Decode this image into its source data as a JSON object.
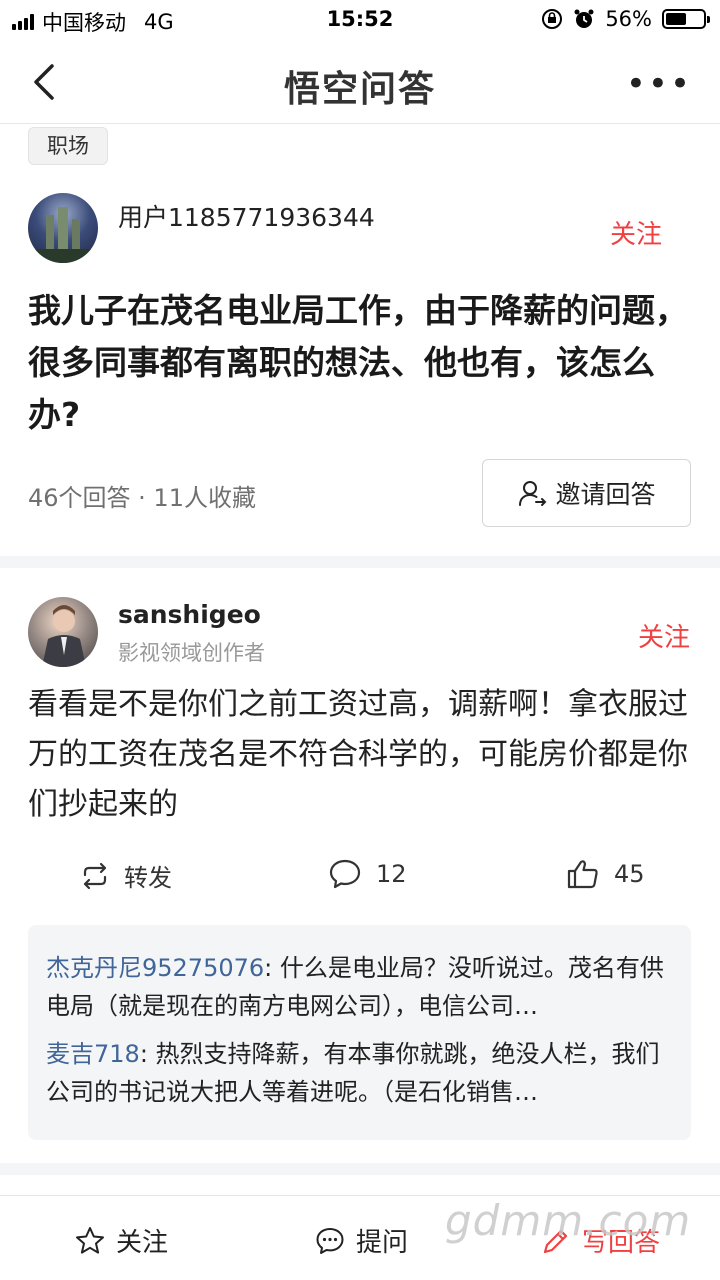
{
  "status_bar": {
    "carrier": "中国移动",
    "network": "4G",
    "time": "15:52",
    "battery_percent": "56%",
    "battery_level": 0.56
  },
  "nav": {
    "title": "悟空问答",
    "more_label": "•••"
  },
  "question": {
    "tag": "职场",
    "asker_name": "用户1185771936344",
    "follow_label": "关注",
    "text": "我儿子在茂名电业局工作，由于降薪的问题，很多同事都有离职的想法、他也有，该怎么办?",
    "meta": "46个回答 · 11人收藏",
    "invite_label": "邀请回答"
  },
  "answer": {
    "author": "sanshigeo",
    "role": "影视领域创作者",
    "follow_label": "关注",
    "text": "看看是不是你们之前工资过高，调薪啊！拿衣服过万的工资在茂名是不符合科学的，可能房价都是你们抄起来的",
    "repost_label": "转发",
    "comment_count": "12",
    "like_count": "45",
    "comments": [
      {
        "author": "杰克丹尼95275076",
        "text": ": 什么是电业局？没听说过。茂名有供电局（就是现在的南方电网公司），电信公司…"
      },
      {
        "author": "麦吉718",
        "text": ": 热烈支持降薪，有本事你就跳，绝没人栏，我们公司的书记说大把人等着进呢。（是石化销售…"
      }
    ]
  },
  "bottom_bar": {
    "follow_label": "关注",
    "ask_label": "提问",
    "write_label": "写回答"
  },
  "watermark": "gdmm.com",
  "colors": {
    "accent_red": "#f04142",
    "comment_author_blue": "#406599"
  }
}
